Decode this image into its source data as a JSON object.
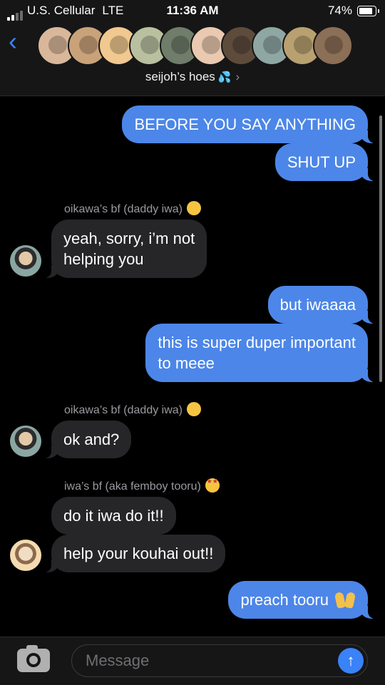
{
  "status_bar": {
    "carrier": "U.S. Cellular",
    "network": "LTE",
    "time": "11:36 AM",
    "battery": "74%"
  },
  "header": {
    "back_icon": "chevron-left-icon",
    "group_name": "seijoh’s hoes",
    "group_emoji": "💦",
    "detail_icon": "chevron-right-icon",
    "participant_count": 10
  },
  "messages": [
    {
      "direction": "sent",
      "text": "BEFORE YOU SAY ANYTHING"
    },
    {
      "direction": "sent",
      "text": "SHUT UP"
    },
    {
      "direction": "received",
      "sender": "oikawa’s bf (daddy iwa)",
      "sender_emoji": "🤫",
      "text_lines": [
        "yeah, sorry, i’m not",
        "helping you"
      ]
    },
    {
      "direction": "sent",
      "text": "but iwaaaa"
    },
    {
      "direction": "sent",
      "text_lines": [
        "this is super duper important",
        "to meee"
      ]
    },
    {
      "direction": "received",
      "sender": "oikawa’s bf (daddy iwa)",
      "sender_emoji": "🤫",
      "text": "ok and?"
    },
    {
      "direction": "received",
      "sender": "iwa’s bf (aka femboy tooru)",
      "sender_emoji": "🤩",
      "text": "do it iwa do it!!"
    },
    {
      "direction": "received",
      "text": "help your kouhai out!!"
    },
    {
      "direction": "sent",
      "text": "preach tooru",
      "emoji": "🙌"
    }
  ],
  "composer": {
    "camera_icon": "camera-icon",
    "placeholder": "Message",
    "value": "",
    "send_icon": "arrow-up-icon"
  },
  "colors": {
    "sent_bubble": "#4c86e8",
    "received_bubble": "#262629",
    "accent": "#3b82f6",
    "background": "#000000"
  }
}
